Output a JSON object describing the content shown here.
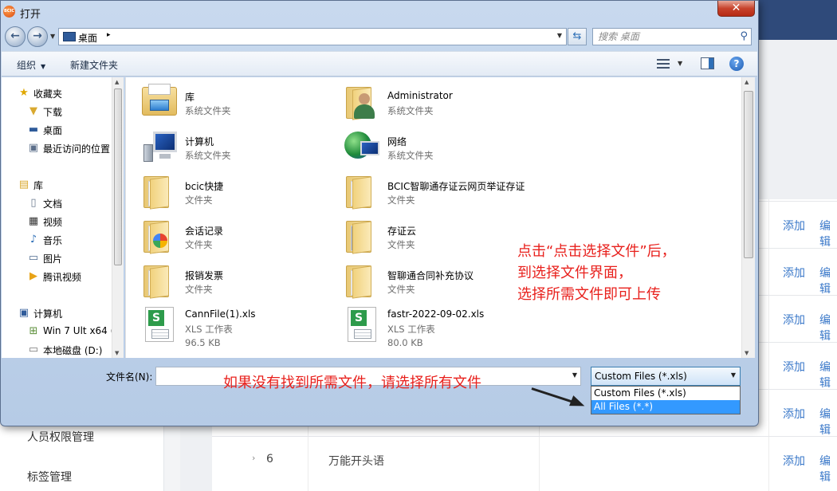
{
  "background_app": {
    "sidebar": [
      "人员权限管理",
      "标签管理"
    ],
    "rows": [
      {
        "num": "",
        "name": "",
        "add": "添加",
        "edit": "编辑"
      },
      {
        "num": "",
        "name": "",
        "add": "添加",
        "edit": "编辑"
      },
      {
        "num": "",
        "name": "",
        "add": "添加",
        "edit": "编辑"
      },
      {
        "num": "",
        "name": "",
        "add": "添加",
        "edit": "编辑"
      },
      {
        "num": "",
        "name": "",
        "add": "添加",
        "edit": "编辑"
      },
      {
        "num": "6",
        "name": "万能开头语",
        "add": "添加",
        "edit": "编辑"
      }
    ]
  },
  "dialog": {
    "title": "打开",
    "app_icon_text": "BCIC",
    "close_label": "✕",
    "address": {
      "location": "桌面",
      "separator": "▸"
    },
    "search_placeholder": "搜索 桌面",
    "toolbar": {
      "organize": "组织",
      "new_folder": "新建文件夹"
    },
    "nav_pane": [
      {
        "label": "收藏夹",
        "icon": "star-icon",
        "level": 0
      },
      {
        "label": "下载",
        "icon": "download-folder-icon",
        "level": 1
      },
      {
        "label": "桌面",
        "icon": "desktop-icon",
        "level": 1
      },
      {
        "label": "最近访问的位置",
        "icon": "recent-places-icon",
        "level": 1
      },
      {
        "label": "库",
        "icon": "library-icon",
        "level": 0
      },
      {
        "label": "文档",
        "icon": "documents-icon",
        "level": 1
      },
      {
        "label": "视频",
        "icon": "video-icon",
        "level": 1
      },
      {
        "label": "音乐",
        "icon": "music-icon",
        "level": 1
      },
      {
        "label": "图片",
        "icon": "pictures-icon",
        "level": 1
      },
      {
        "label": "腾讯视频",
        "icon": "tencent-video-icon",
        "level": 1
      },
      {
        "label": "计算机",
        "icon": "computer-icon",
        "level": 0
      },
      {
        "label": "Win 7 Ult x64 (",
        "icon": "drive-c-icon",
        "level": 1
      },
      {
        "label": "本地磁盘 (D:)",
        "icon": "drive-d-icon",
        "level": 1
      }
    ],
    "files": [
      {
        "name": "库",
        "type": "系统文件夹",
        "size": "",
        "icon": "library-icon"
      },
      {
        "name": "Administrator",
        "type": "系统文件夹",
        "size": "",
        "icon": "user-folder-icon"
      },
      {
        "name": "计算机",
        "type": "系统文件夹",
        "size": "",
        "icon": "computer-icon"
      },
      {
        "name": "网络",
        "type": "系统文件夹",
        "size": "",
        "icon": "network-icon"
      },
      {
        "name": "bcic快捷",
        "type": "文件夹",
        "size": "",
        "icon": "folder-icon"
      },
      {
        "name": "BCIC智聊通存证云网页举证存证",
        "type": "文件夹",
        "size": "",
        "icon": "folder-icon"
      },
      {
        "name": "会话记录",
        "type": "文件夹",
        "size": "",
        "icon": "folder-icon"
      },
      {
        "name": "存证云",
        "type": "文件夹",
        "size": "",
        "icon": "folder-icon"
      },
      {
        "name": "报销发票",
        "type": "文件夹",
        "size": "",
        "icon": "folder-icon"
      },
      {
        "name": "智聊通合同补充协议",
        "type": "文件夹",
        "size": "",
        "icon": "folder-icon"
      },
      {
        "name": "CannFile(1).xls",
        "type": "XLS 工作表",
        "size": "96.5 KB",
        "icon": "xls-file-icon"
      },
      {
        "name": "fastr-2022-09-02.xls",
        "type": "XLS 工作表",
        "size": "80.0 KB",
        "icon": "xls-file-icon"
      }
    ],
    "filename_label": "文件名(N):",
    "filename_value": "",
    "filetype_selected": "Custom Files (*.xls)",
    "filetype_options": [
      "Custom Files (*.xls)",
      "All Files (*.*)"
    ],
    "filetype_highlighted_index": 1
  },
  "annotations": {
    "right_note": [
      "点击“点击选择文件”后，",
      "到选择文件界面，",
      "选择所需文件即可上传"
    ],
    "bottom_note": "如果没有找到所需文件，请选择所有文件",
    "color": "#e8201c"
  }
}
